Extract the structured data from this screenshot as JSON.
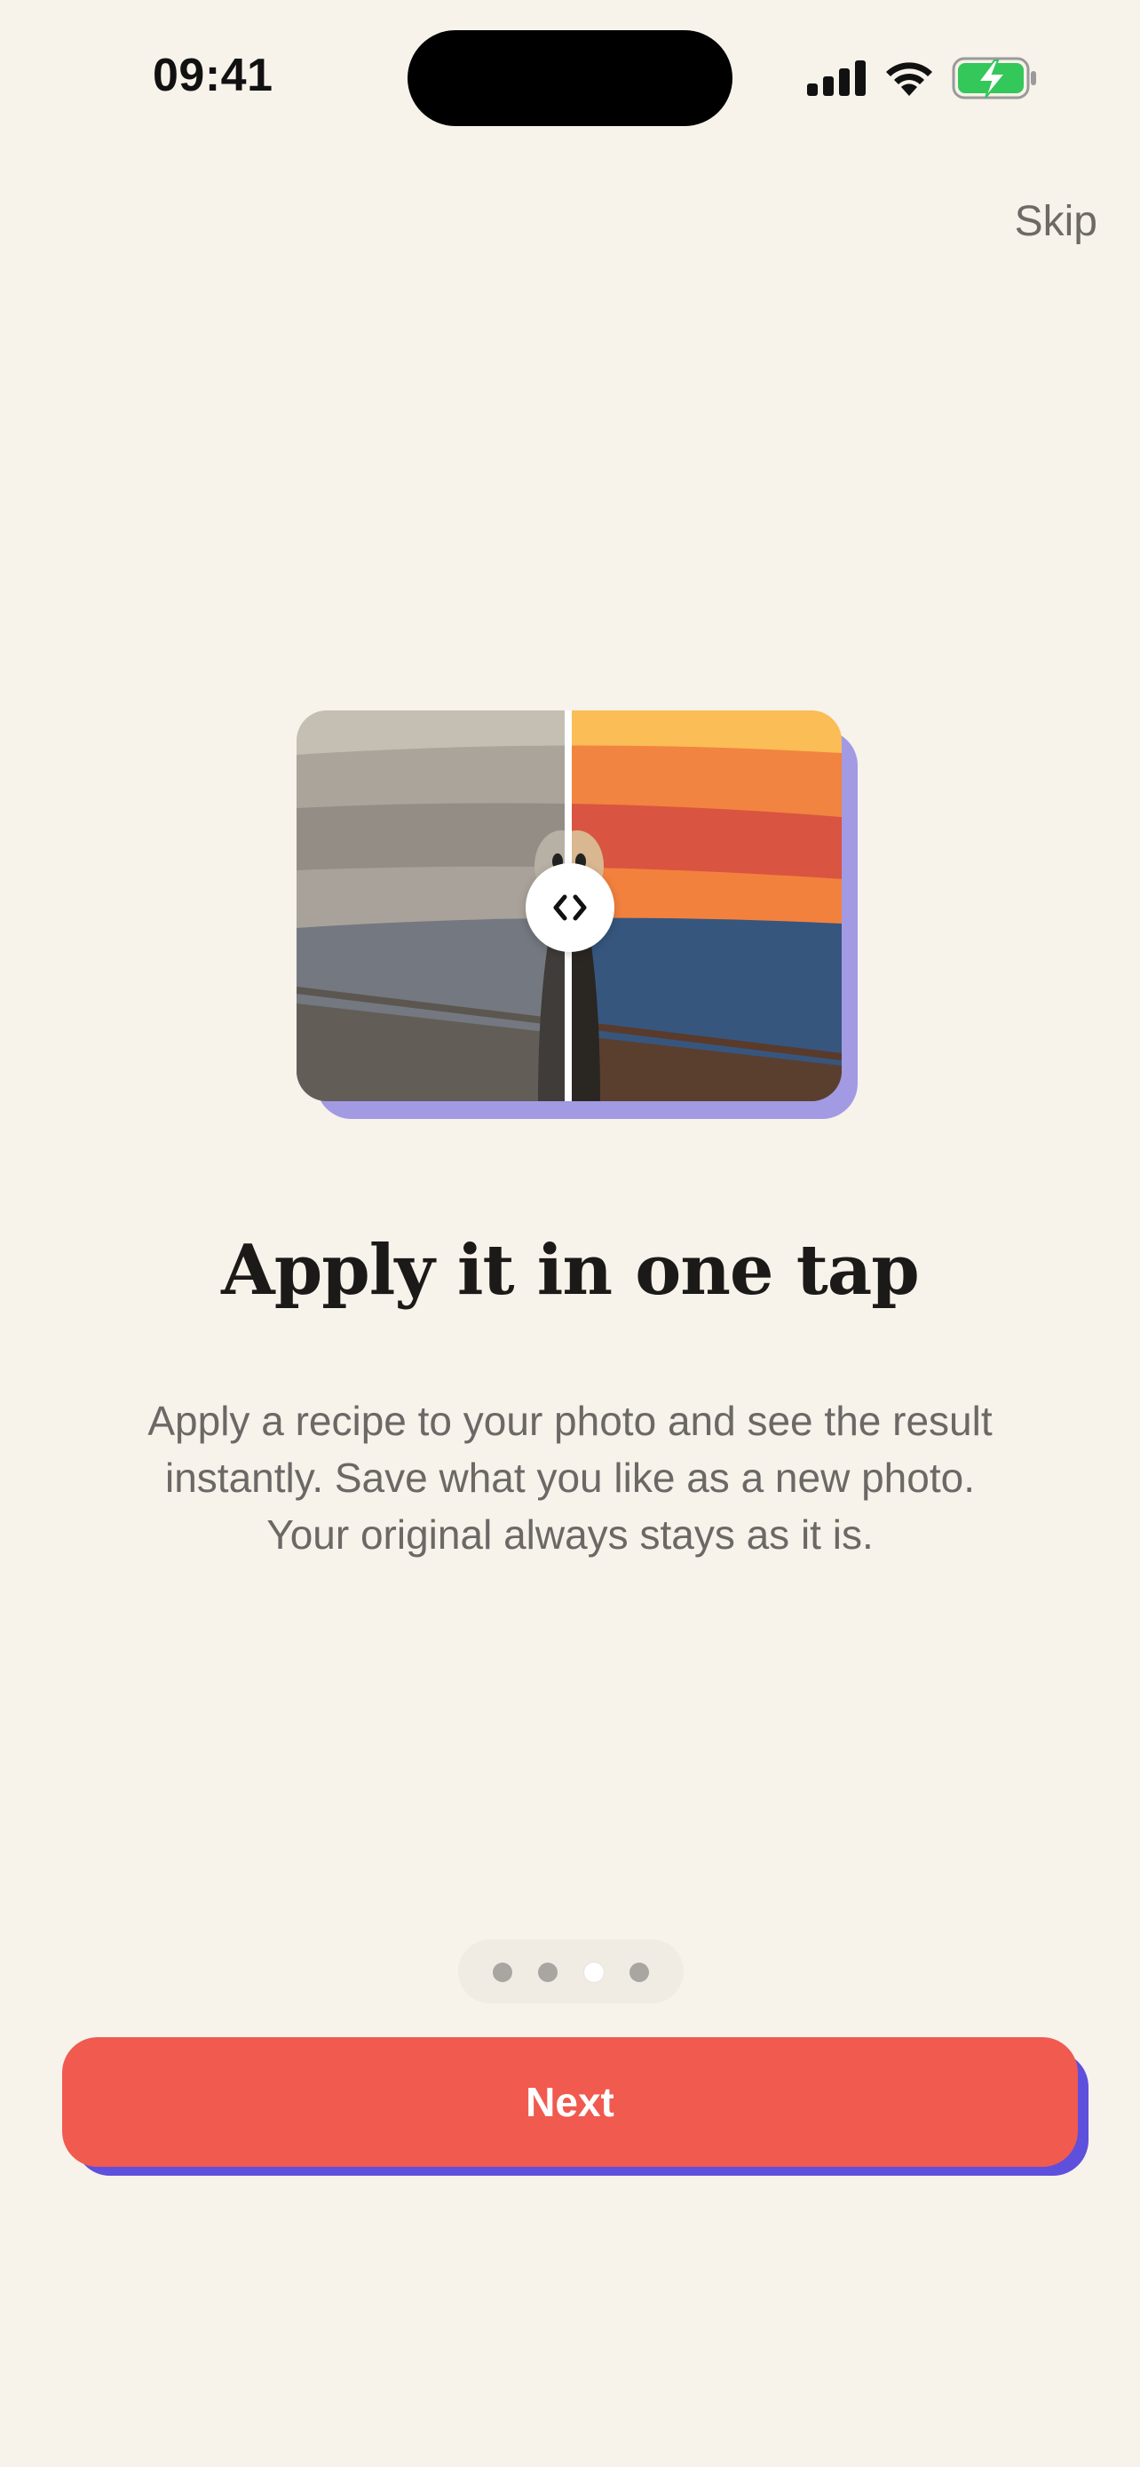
{
  "status_bar": {
    "time": "09:41",
    "signal_icon": "cellular-signal-icon",
    "wifi_icon": "wifi-icon",
    "battery_icon": "battery-charging-icon",
    "battery_color": "#34c759"
  },
  "header": {
    "skip_label": "Skip"
  },
  "illustration": {
    "description_icon": "before-after-compare-image",
    "handle_icon": "chevron-left-right-icon",
    "accent_shadow_color": "#a29ae3"
  },
  "content": {
    "title": "Apply it in one tap",
    "description_lines": [
      "Apply a recipe to your photo and see the result",
      "instantly. Save what you like as a new photo.",
      "Your original always stays as it is."
    ]
  },
  "pagination": {
    "total": 4,
    "current": 3
  },
  "footer": {
    "next_label": "Next",
    "button_color": "#f05a4f",
    "button_shadow_color": "#5e4fdc"
  }
}
